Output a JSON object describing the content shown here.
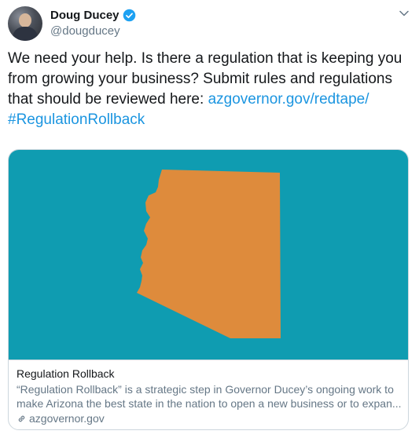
{
  "user": {
    "name": "Doug Ducey",
    "handle": "@dougducey",
    "verified": true
  },
  "tweet": {
    "text": "We need your help. Is there a regulation that is keeping you from growing your business? Submit rules and regulations that should be reviewed here: ",
    "link": "azgovernor.gov/redtape/",
    "hashtag": "#RegulationRollback"
  },
  "card": {
    "title": "Regulation Rollback",
    "description_line1": "“Regulation Rollback” is a strategic step in Governor Ducey’s ongoing work to",
    "description_line2": "make Arizona the best state in the nation to open a new business or to expan...",
    "domain": "azgovernor.gov",
    "image_bg_color": "#0f9cb1",
    "shape_color": "#de8b3c"
  },
  "colors": {
    "link": "#1b95e0",
    "verified": "#1da1f2",
    "secondary_text": "#657786"
  },
  "icons": {
    "verified": "verified-badge-icon",
    "menu": "chevron-down-icon",
    "link": "link-icon"
  }
}
